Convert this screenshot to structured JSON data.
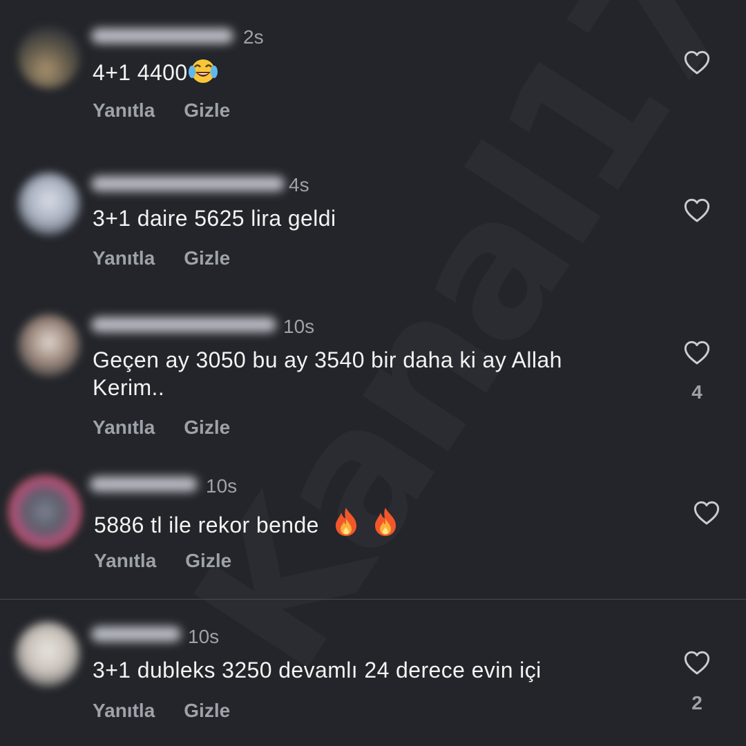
{
  "labels": {
    "reply": "Yanıtla",
    "hide": "Gizle"
  },
  "watermark": "Kanal17",
  "comments": [
    {
      "time": "2s",
      "text": "4+1 4400",
      "emoji": "face-with-tears-of-joy",
      "likes": ""
    },
    {
      "time": "4s",
      "text": "3+1 daire 5625 lira geldi",
      "likes": ""
    },
    {
      "time": "10s",
      "text": "Geçen ay 3050 bu ay 3540 bir daha ki ay Allah Kerim..",
      "likes": "4"
    },
    {
      "time": "10s",
      "text": "5886 tl ile rekor bende",
      "emoji": "fire",
      "likes": ""
    },
    {
      "time": "10s",
      "text": "3+1 dubleks 3250 devamlı 24 derece evin içi",
      "likes": "2"
    }
  ],
  "colors": {
    "background": "#23252a",
    "text": "#f3f3f3",
    "muted": "#9ea2a9"
  }
}
